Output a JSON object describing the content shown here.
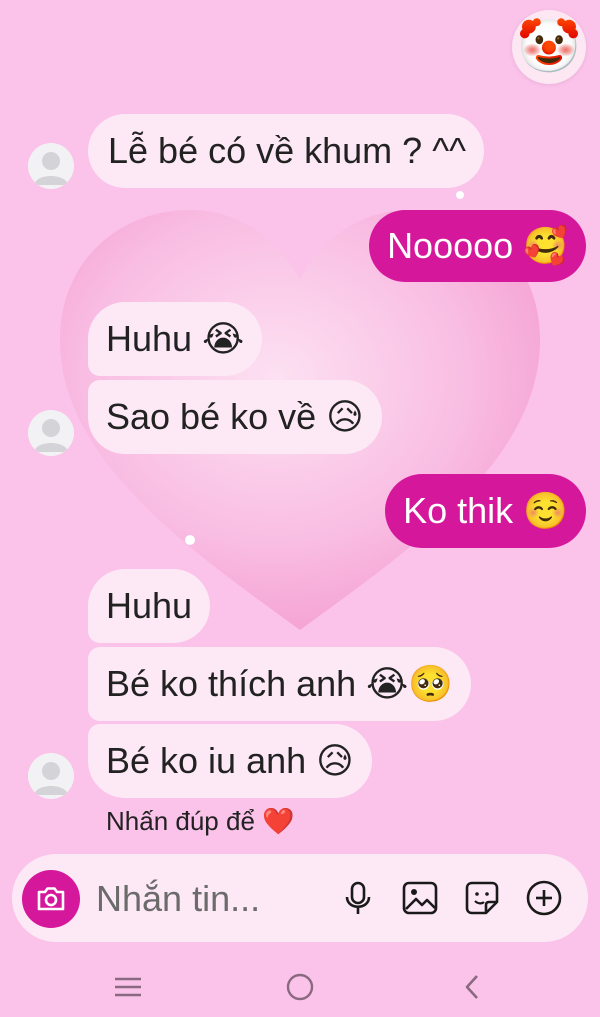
{
  "reaction": {
    "emoji": "🤡"
  },
  "messages": [
    {
      "id": "m1",
      "side": "incoming",
      "text": "Lễ bé có về khum ? ^^"
    },
    {
      "id": "m2",
      "side": "outgoing",
      "text": "Nooooo 🥰"
    },
    {
      "id": "m3",
      "side": "incoming",
      "text": "Huhu 😭"
    },
    {
      "id": "m4",
      "side": "incoming",
      "text": "Sao bé ko về 😥"
    },
    {
      "id": "m5",
      "side": "outgoing",
      "text": "Ko thik ☺️"
    },
    {
      "id": "m6",
      "side": "incoming",
      "text": "Huhu"
    },
    {
      "id": "m7",
      "side": "incoming",
      "text": "Bé ko thích anh 😭🥺"
    },
    {
      "id": "m8",
      "side": "incoming",
      "text": "Bé ko iu anh 😥"
    }
  ],
  "hint": {
    "text": "Nhấn đúp để ❤️"
  },
  "composer": {
    "placeholder": "Nhắn tin..."
  },
  "icons": {
    "camera": "camera-icon",
    "mic": "microphone-icon",
    "image": "image-icon",
    "sticker": "sticker-icon",
    "plus": "plus-circle-icon",
    "nav_recents": "recent-apps-icon",
    "nav_home": "home-icon",
    "nav_back": "back-icon"
  },
  "colors": {
    "background": "#fbc2ea",
    "outgoing_bubble": "#d5189b",
    "incoming_bubble": "#fde9f6"
  }
}
